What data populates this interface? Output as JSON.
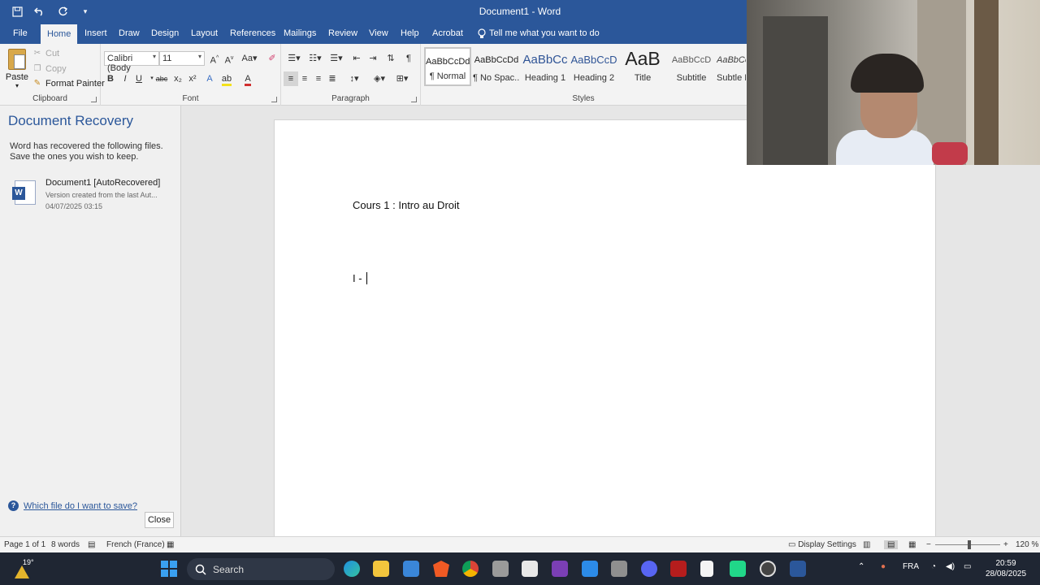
{
  "window": {
    "title": "Document1 - Word"
  },
  "qat": {
    "save": "save-icon",
    "undo": "undo-icon",
    "redo": "redo-icon",
    "more": "customize-icon"
  },
  "tabs": [
    "File",
    "Home",
    "Insert",
    "Draw",
    "Design",
    "Layout",
    "References",
    "Mailings",
    "Review",
    "View",
    "Help",
    "Acrobat"
  ],
  "tell_me": "Tell me what you want to do",
  "clipboard": {
    "paste": "Paste",
    "cut": "Cut",
    "copy": "Copy",
    "format_painter": "Format Painter",
    "label": "Clipboard"
  },
  "font": {
    "name": "Calibri (Body",
    "size": "11",
    "label": "Font",
    "buttons": [
      "B",
      "I",
      "U",
      "abc",
      "x₂",
      "x²"
    ]
  },
  "paragraph": {
    "label": "Paragraph"
  },
  "styles": {
    "label": "Styles",
    "items": [
      {
        "sample": "AaBbCcDd",
        "name": "¶ Normal"
      },
      {
        "sample": "AaBbCcDd",
        "name": "¶ No Spac..."
      },
      {
        "sample": "AaBbCc",
        "name": "Heading 1"
      },
      {
        "sample": "AaBbCcD",
        "name": "Heading 2"
      },
      {
        "sample": "AaB",
        "name": "Title"
      },
      {
        "sample": "AaBbCcD",
        "name": "Subtitle"
      },
      {
        "sample": "AaBbCc",
        "name": "Subtle E"
      }
    ]
  },
  "recovery": {
    "title": "Document Recovery",
    "description": "Word has recovered the following files. Save the ones you wish to keep.",
    "file": {
      "name": "Document1  [AutoRecovered]",
      "sub": "Version created from the last Aut...",
      "date": "04/07/2025 03:15"
    },
    "help": "Which file do I want to save?",
    "close": "Close"
  },
  "document": {
    "line1": "Cours 1 : Intro au Droit",
    "line2": "I - "
  },
  "status": {
    "page": "Page 1 of 1",
    "words": "8 words",
    "language": "French (France)",
    "display": "Display Settings",
    "zoom": "120 %"
  },
  "taskbar": {
    "temp": "19°",
    "search": "Search",
    "lang": "FRA",
    "time": "20:59",
    "date": "28/08/2025"
  },
  "colors": {
    "brand": "#2b579a",
    "taskbar": "#1f2633"
  }
}
